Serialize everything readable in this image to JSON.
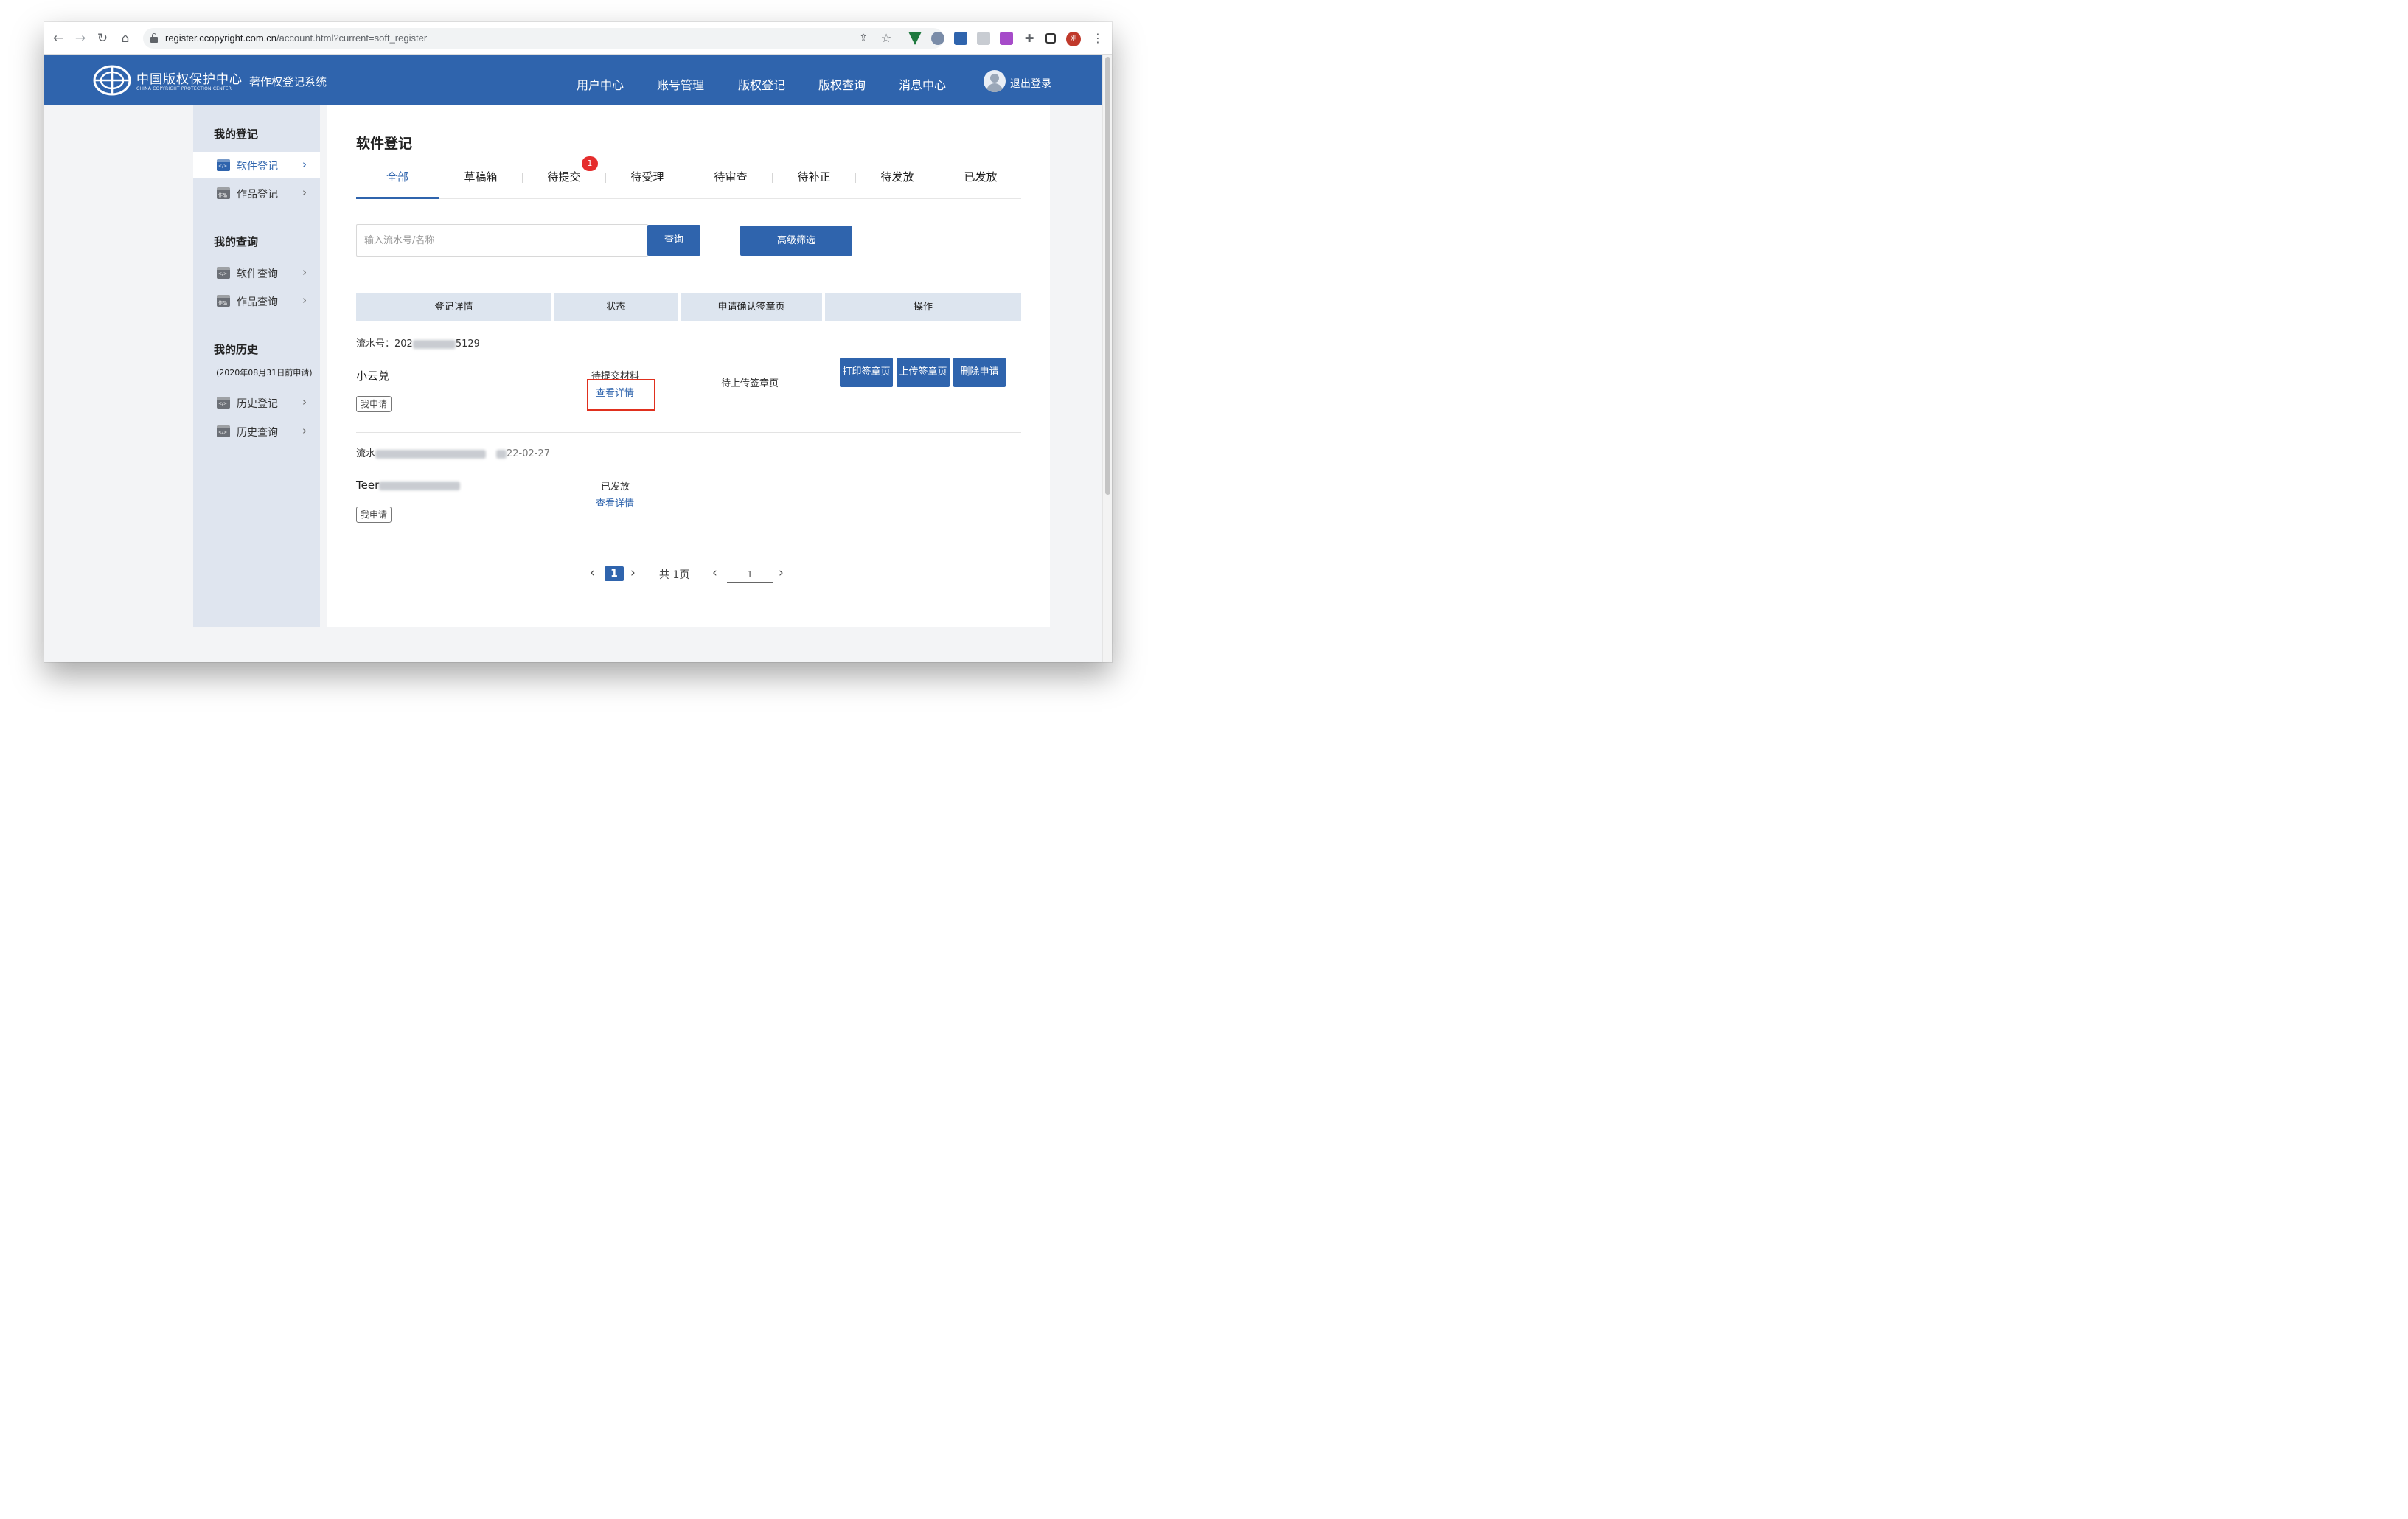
{
  "browser": {
    "url_domain": "register.ccopyright.com.cn",
    "url_path": "/account.html?current=soft_register",
    "profile_initial": "刚"
  },
  "header": {
    "logo_cn": "中国版权保护中心",
    "logo_en": "CHINA COPYRIGHT PROTECTION CENTER",
    "system_name": "著作权登记系统",
    "nav": [
      "用户中心",
      "账号管理",
      "版权登记",
      "版权查询",
      "消息中心"
    ],
    "logout": "退出登录"
  },
  "sidebar": {
    "group_register": "我的登记",
    "item_soft_register": "软件登记",
    "item_work_register": "作品登记",
    "group_query": "我的查询",
    "item_soft_query": "软件查询",
    "item_work_query": "作品查询",
    "group_history": "我的历史",
    "history_note": "(2020年08月31日前申请)",
    "item_history_register": "历史登记",
    "item_history_query": "历史查询",
    "icon_code_text": "</>",
    "icon_work_text": "作品"
  },
  "main": {
    "title": "软件登记",
    "tabs": [
      "全部",
      "草稿箱",
      "待提交",
      "待受理",
      "待审查",
      "待补正",
      "待发放",
      "已发放"
    ],
    "active_tab": "全部",
    "pending_badge": "1",
    "search_placeholder": "输入流水号/名称",
    "search_button": "查询",
    "filter_button": "高级筛选",
    "columns": [
      "登记详情",
      "状态",
      "申请确认签章页",
      "操作"
    ]
  },
  "records": [
    {
      "serial_prefix": "流水号：202",
      "serial_suffix": "5129",
      "name": "小云兑",
      "tag": "我申请",
      "status": "待提交材料",
      "detail_link": "查看详情",
      "sign_status": "待上传签章页",
      "actions": [
        "打印签章页",
        "上传签章页",
        "删除申请"
      ]
    },
    {
      "serial_prefix": "流水",
      "serial_suffix": "22-02-27",
      "name": "Teer",
      "tag": "我申请",
      "status": "已发放",
      "detail_link": "查看详情"
    }
  ],
  "pagination": {
    "current": "1",
    "total": "共 1页",
    "goto_value": "1"
  },
  "colors": {
    "primary": "#2f64ad",
    "header_bg": "#2f64ad",
    "sidebar_bg": "#dfe5ef",
    "table_header_bg": "#dde5ef",
    "badge_red": "#e52d2d",
    "highlight_box": "#e0301e"
  }
}
